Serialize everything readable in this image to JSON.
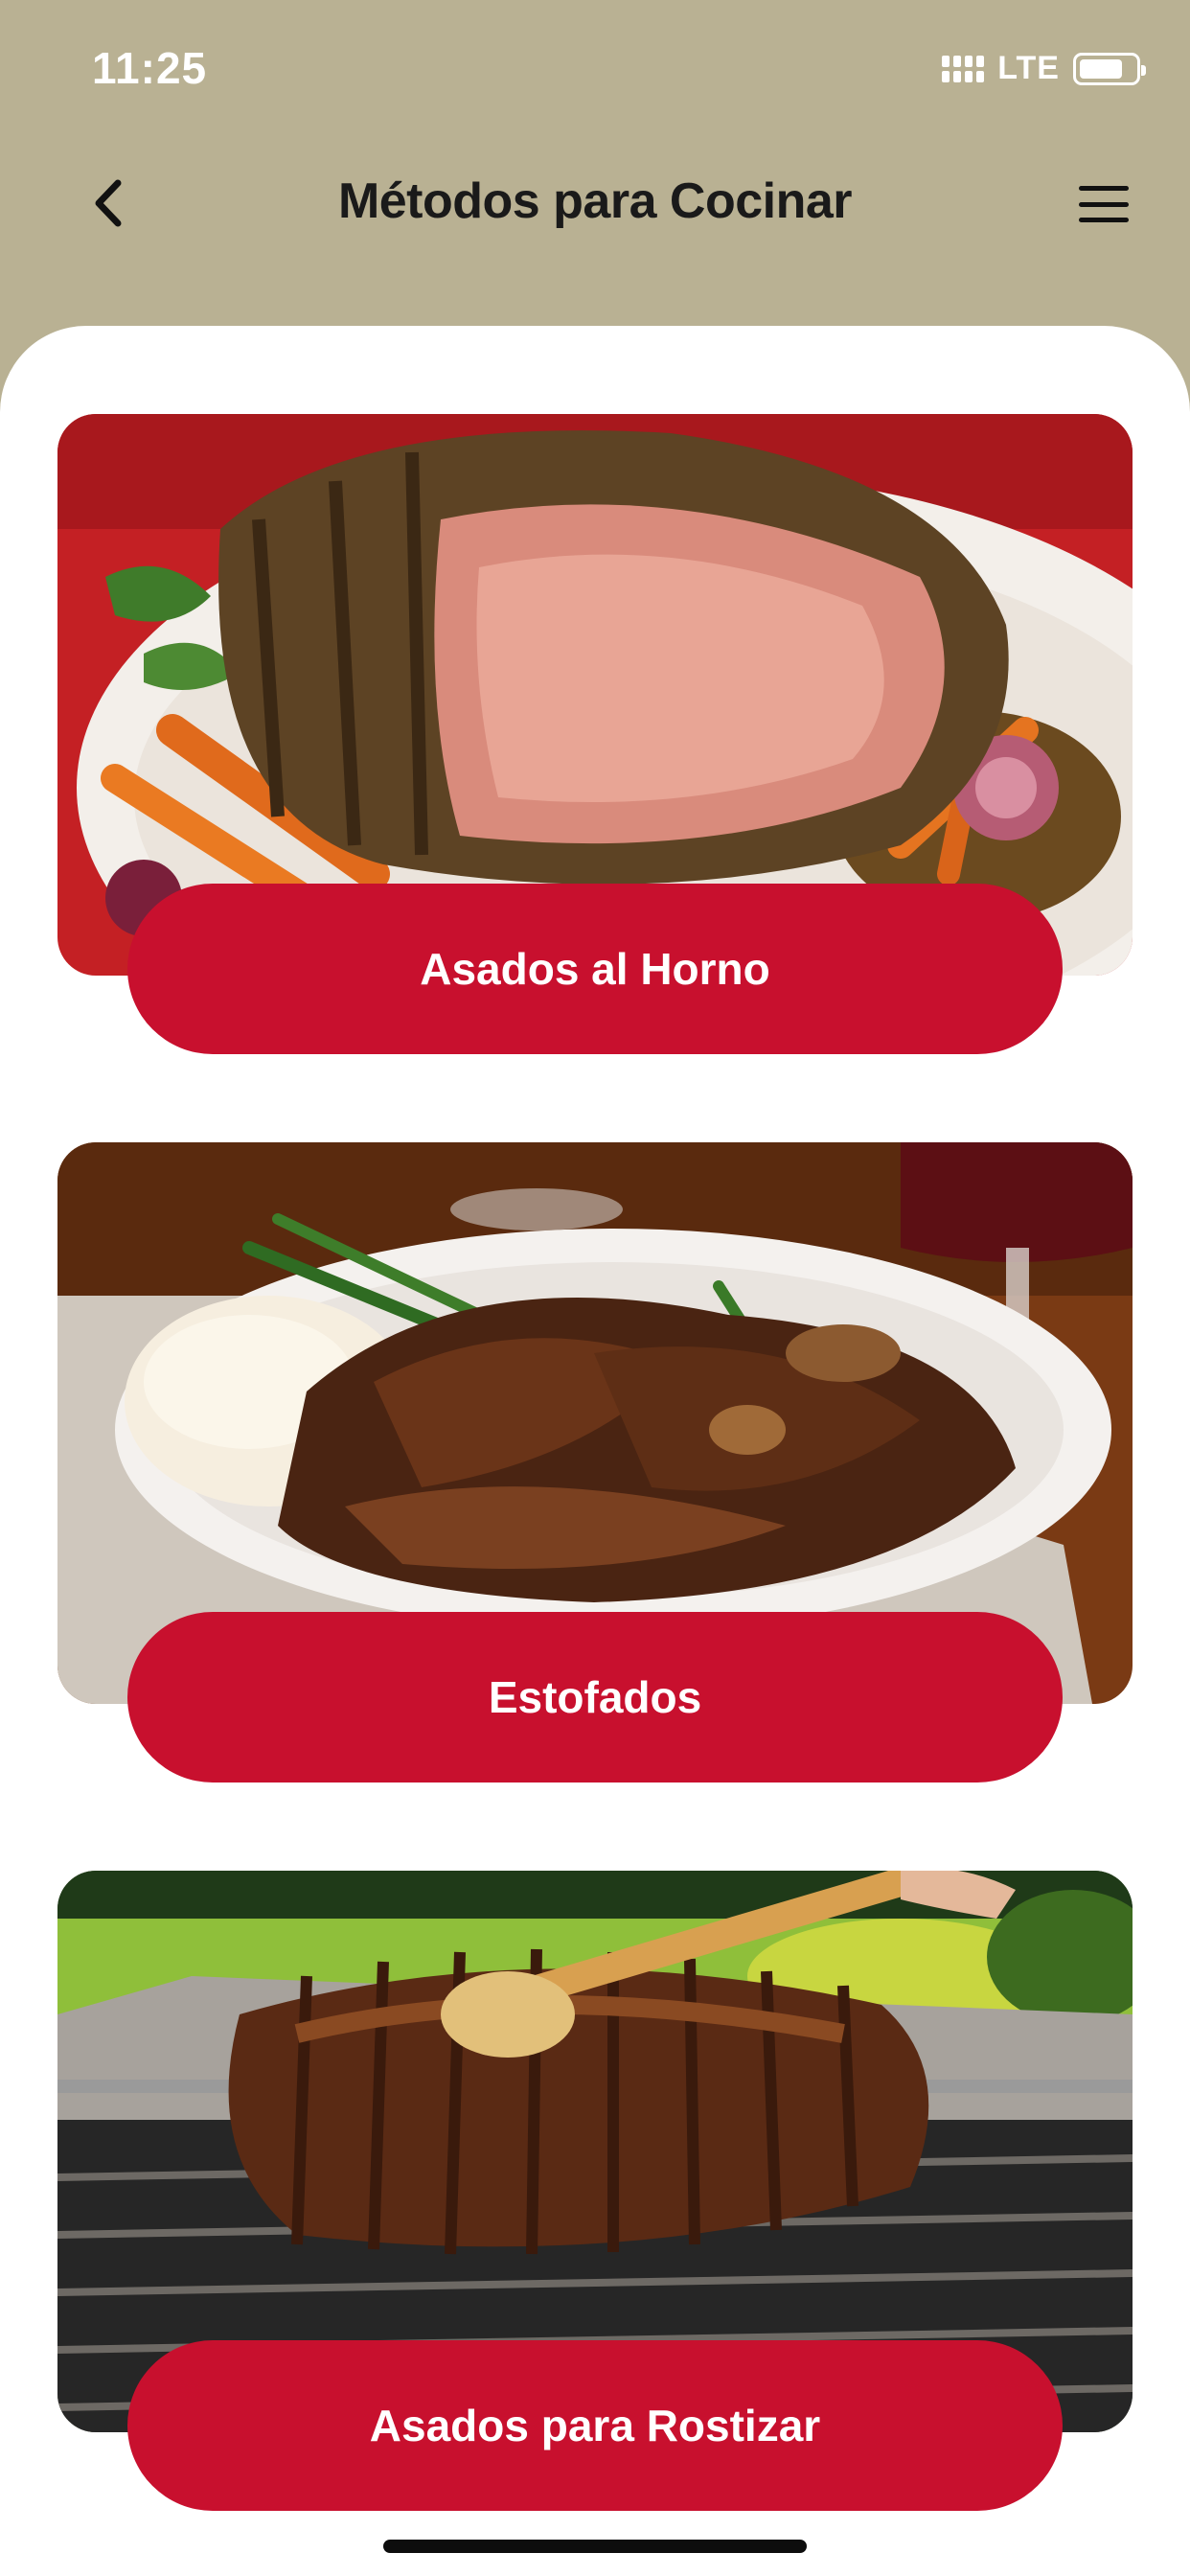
{
  "status_bar": {
    "time": "11:25",
    "network": "LTE",
    "icons": [
      "signal-icon",
      "battery-icon"
    ]
  },
  "nav": {
    "title": "Métodos para Cocinar",
    "back_icon": "chevron-left-icon",
    "menu_icon": "hamburger-menu-icon"
  },
  "methods": [
    {
      "label": "Asados al Horno",
      "image": "prime-rib-roast-photo"
    },
    {
      "label": "Estofados",
      "image": "pot-roast-stew-photo"
    },
    {
      "label": "Asados para Rostizar",
      "image": "rotisserie-roast-photo"
    }
  ],
  "colors": {
    "header_background": "#b9b193",
    "button_red": "#c8102e",
    "content_background": "#ffffff"
  }
}
